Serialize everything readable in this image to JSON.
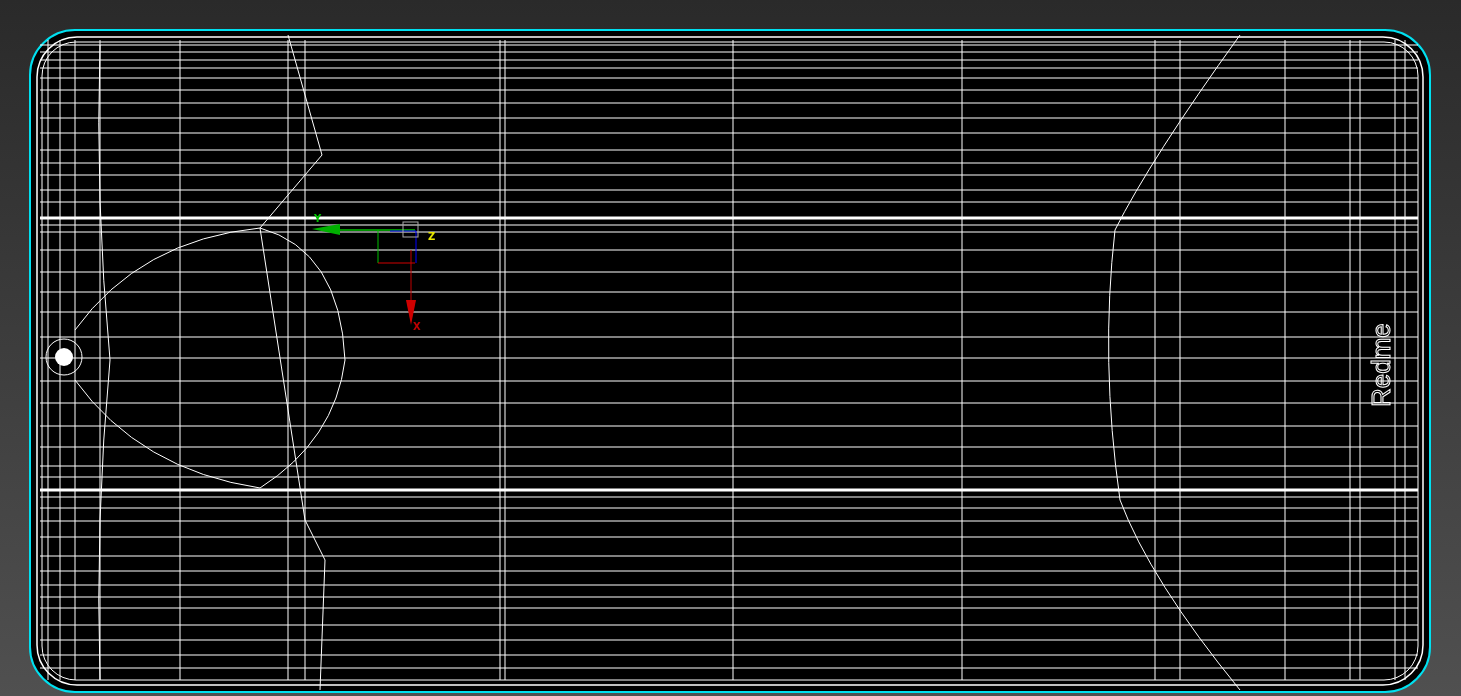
{
  "viewport": {
    "model": {
      "selected": true,
      "logo_text": "Redme"
    },
    "gizmo_axes": [
      {
        "label": "Y"
      },
      {
        "label": "Z"
      },
      {
        "label": "X"
      }
    ]
  }
}
